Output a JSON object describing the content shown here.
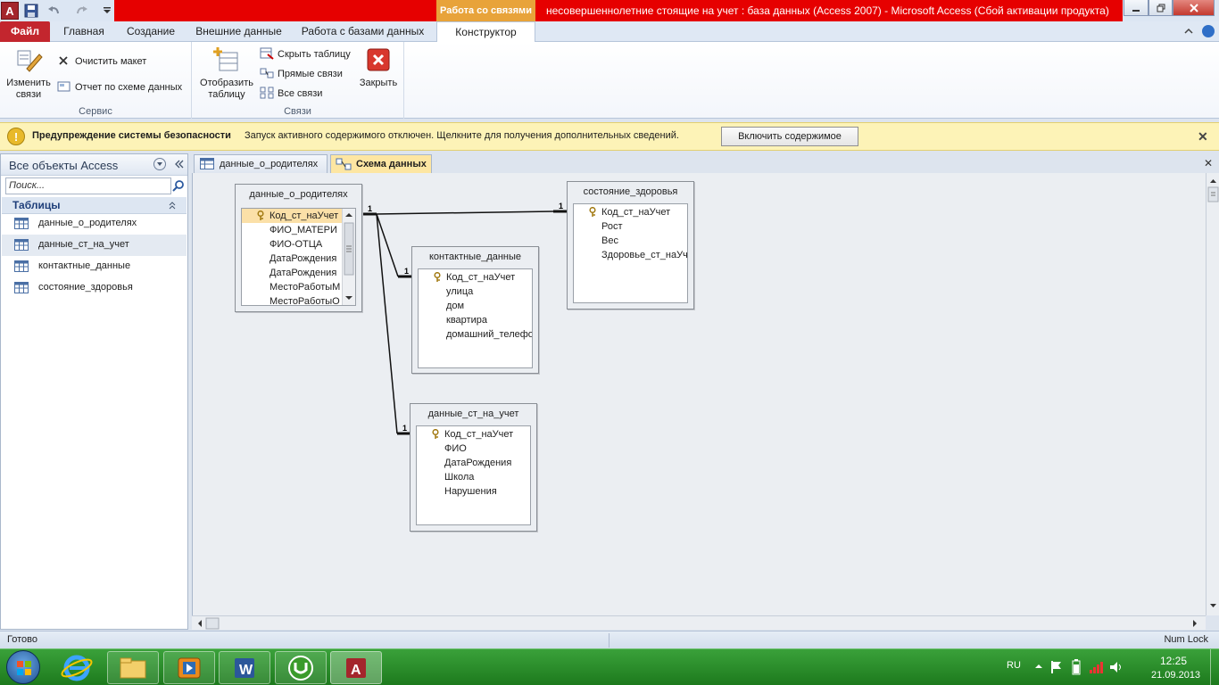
{
  "window": {
    "app_icon_letter": "A",
    "context_tab_title": "Работа со связями",
    "document_title": "несовершеннолетние стоящие на учет : база данных (Access 2007)  -  Microsoft Access (Сбой активации продукта)"
  },
  "tabs": [
    {
      "label": "Файл"
    },
    {
      "label": "Главная"
    },
    {
      "label": "Создание"
    },
    {
      "label": "Внешние данные"
    },
    {
      "label": "Работа с базами данных"
    },
    {
      "label": "Конструктор"
    }
  ],
  "ribbon": {
    "service": {
      "label": "Сервис",
      "edit_relations": "Изменить\nсвязи",
      "clear_layout": "Очистить макет",
      "relations_report": "Отчет по схеме данных"
    },
    "relations": {
      "label": "Связи",
      "show_table": "Отобразить\nтаблицу",
      "hide_table": "Скрыть таблицу",
      "direct_relations": "Прямые связи",
      "all_relations": "Все связи",
      "close": "Закрыть"
    }
  },
  "security_bar": {
    "title": "Предупреждение системы безопасности",
    "message": "Запуск активного содержимого отключен. Щелкните для получения дополнительных сведений.",
    "button": "Включить содержимое"
  },
  "nav_pane": {
    "header": "Все объекты Access",
    "search_placeholder": "Поиск...",
    "category": "Таблицы",
    "items": [
      {
        "label": "данные_о_родителях"
      },
      {
        "label": "данные_ст_на_учет"
      },
      {
        "label": "контактные_данные"
      },
      {
        "label": "состояние_здоровья"
      }
    ]
  },
  "doc_tabs": [
    {
      "label": "данные_о_родителях"
    },
    {
      "label": "Схема данных"
    }
  ],
  "diagram": {
    "tables": [
      {
        "name": "данные_о_родителях",
        "fields": [
          "Код_ст_наУчет",
          "ФИО_МАТЕРИ",
          "ФИО-ОТЦА",
          "ДатаРождения",
          "ДатаРождения",
          "МестоРаботыМ",
          "МестоРаботыО"
        ]
      },
      {
        "name": "контактные_данные",
        "fields": [
          "Код_ст_наУчет",
          "улица",
          "дом",
          "квартира",
          "домашний_телефо"
        ]
      },
      {
        "name": "состояние_здоровья",
        "fields": [
          "Код_ст_наУчет",
          "Рост",
          "Вес",
          "Здоровье_ст_наУч"
        ]
      },
      {
        "name": "данные_ст_на_учет",
        "fields": [
          "Код_ст_наУчет",
          "ФИО",
          "ДатаРождения",
          "Школа",
          "Нарушения"
        ]
      }
    ],
    "relation_labels": [
      "1",
      "1",
      "1",
      "1"
    ]
  },
  "statusbar": {
    "left": "Готово",
    "right": "Num Lock"
  },
  "tray": {
    "lang": "RU",
    "time": "12:25",
    "date": "21.09.2013"
  }
}
